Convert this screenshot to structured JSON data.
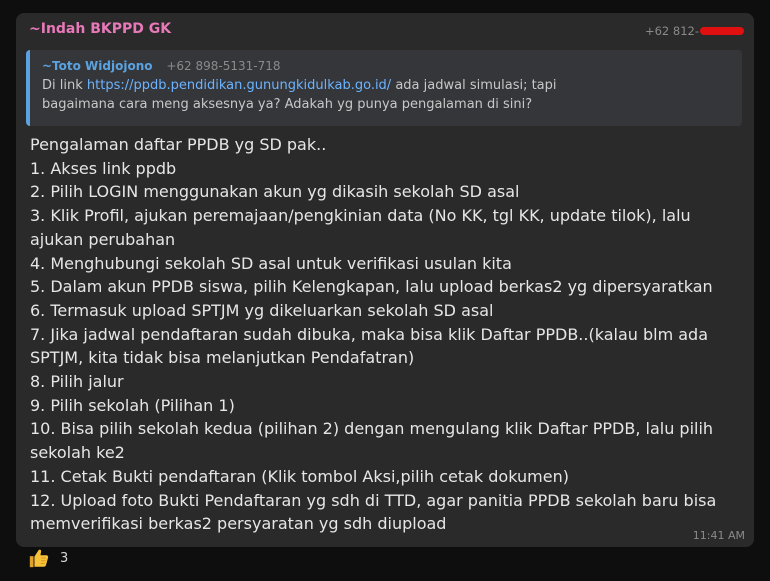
{
  "message": {
    "sender": "~Indah BKPPD GK",
    "sender_phone": "+62 812-",
    "reply": {
      "name": "~Toto Widjojono",
      "phone": "+62 898-5131-718",
      "text_prefix": "Di link ",
      "link": "https://ppdb.pendidikan.gunungkidulkab.go.id/",
      "text_suffix": " ada jadwal simulasi; tapi",
      "text_line2": "bagaimana cara meng aksesnya ya? Adakah yg punya pengalaman di sini?"
    },
    "lines": [
      "Pengalaman daftar PPDB yg SD pak..",
      "1. Akses link ppdb",
      "2. Pilih LOGIN menggunakan akun yg dikasih sekolah SD asal",
      "3. Klik Profil, ajukan peremajaan/pengkinian data (No KK, tgl KK, update tilok), lalu ajukan perubahan",
      "4. Menghubungi sekolah SD asal untuk verifikasi usulan kita",
      "5. Dalam akun PPDB siswa, pilih Kelengkapan, lalu upload berkas2 yg dipersyaratkan",
      "6. Termasuk upload SPTJM yg dikeluarkan sekolah SD asal",
      "7. Jika jadwal pendaftaran sudah dibuka, maka bisa klik Daftar PPDB..(kalau blm ada SPTJM, kita tidak bisa melanjutkan Pendafatran)",
      "8. Pilih jalur",
      "9. Pilih sekolah (Pilihan 1)",
      "10. Bisa pilih sekolah kedua (pilihan 2) dengan mengulang klik Daftar PPDB, lalu pilih sekolah ke2",
      "11. Cetak Bukti pendaftaran (Klik tombol Aksi,pilih cetak dokumen)",
      "12. Upload foto Bukti Pendaftaran yg sdh di TTD, agar panitia PPDB sekolah baru bisa memverifikasi berkas2 persyaratan yg sdh diupload"
    ],
    "time": "11:41 AM"
  },
  "reaction": {
    "icon": "thumbs-up-icon",
    "count": "3"
  },
  "colors": {
    "sender": "#e879b9",
    "reply_accent": "#5aa3e0",
    "redaction": "#e01010"
  }
}
